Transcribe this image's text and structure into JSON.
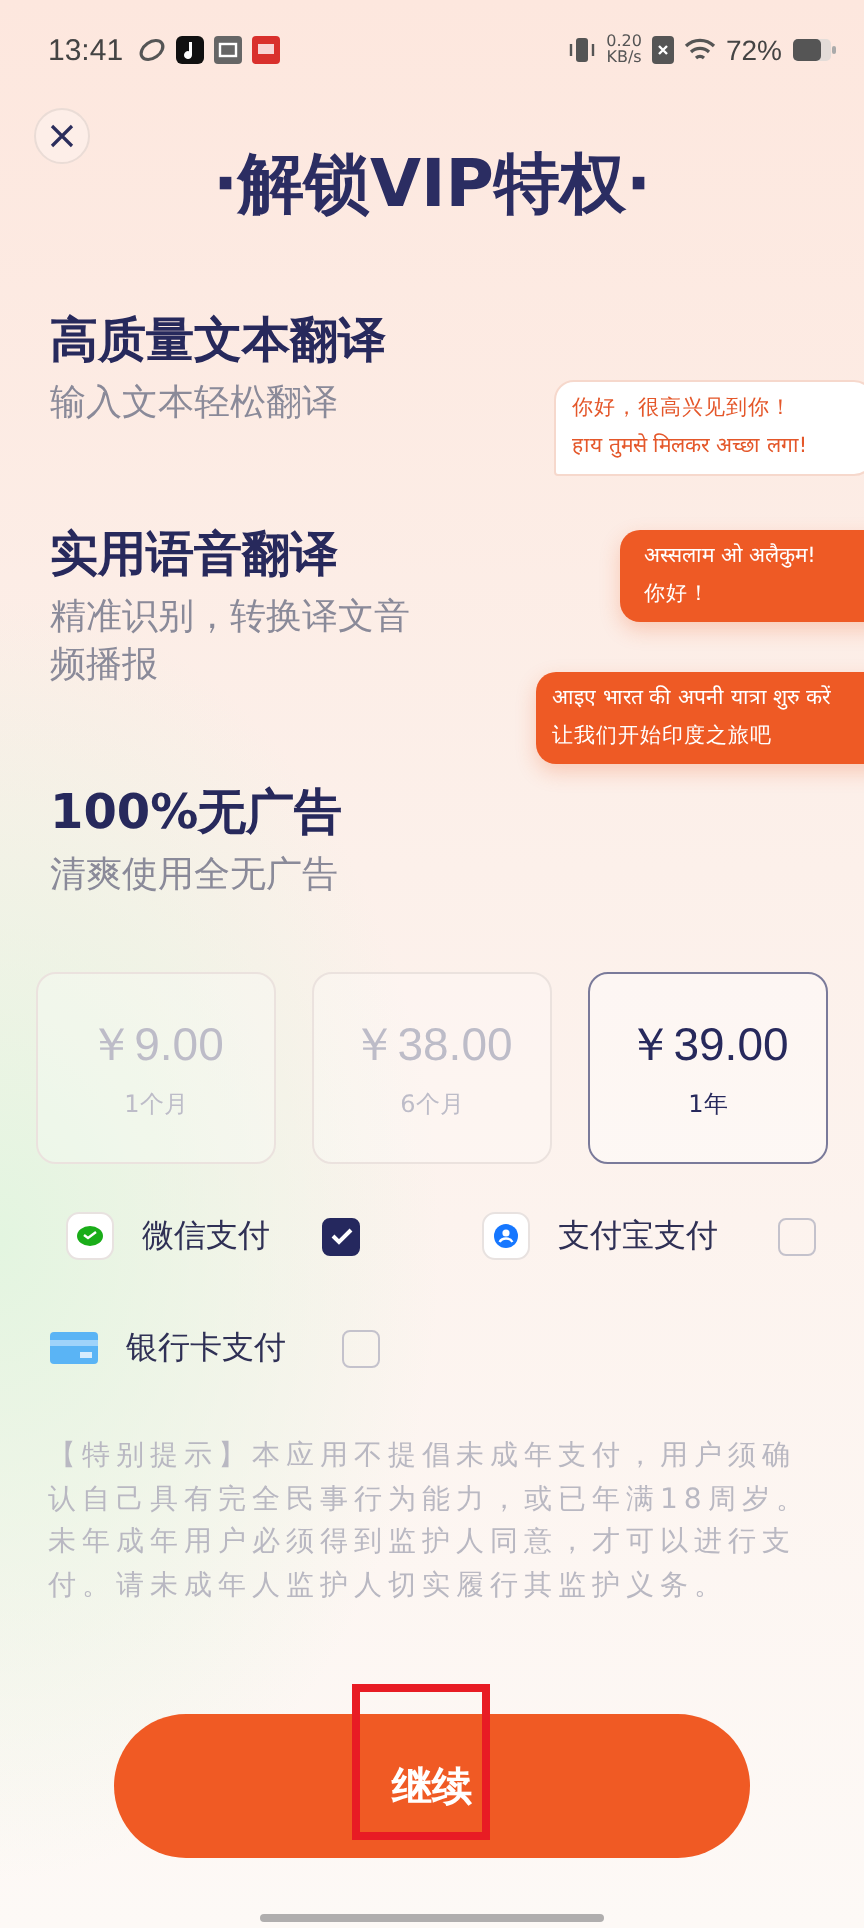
{
  "status_bar": {
    "time": "13:41",
    "net_speed_value": "0.20",
    "net_speed_unit": "KB/s",
    "battery": "72%"
  },
  "title": "·解锁VIP特权·",
  "features": [
    {
      "title": "高质量文本翻译",
      "subtitle": "输入文本轻松翻译"
    },
    {
      "title": "实用语音翻译",
      "subtitle": "精准识别，转换译文音频播报"
    },
    {
      "title": "100%无广告",
      "subtitle": "清爽使用全无广告"
    }
  ],
  "bubbles": [
    {
      "kind": "light",
      "lines": [
        "你好，很高兴见到你！",
        "हाय तुमसे मिलकर अच्छा लगा!"
      ]
    },
    {
      "kind": "dark",
      "lines": [
        "अस्सलाम ओ अलैकुम!",
        "你好！"
      ]
    },
    {
      "kind": "dark",
      "lines": [
        "आइए भारत की अपनी यात्रा शुरु करें",
        "让我们开始印度之旅吧"
      ]
    }
  ],
  "plans": [
    {
      "price": "￥9.00",
      "period": "1个月",
      "selected": false
    },
    {
      "price": "￥38.00",
      "period": "6个月",
      "selected": false
    },
    {
      "price": "￥39.00",
      "period": "1年",
      "selected": true
    }
  ],
  "payment_methods": [
    {
      "kind": "wechat",
      "label": "微信支付",
      "checked": true
    },
    {
      "kind": "alipay",
      "label": "支付宝支付",
      "checked": false
    },
    {
      "kind": "bankcard",
      "label": "银行卡支付",
      "checked": false
    }
  ],
  "notice": "【特别提示】本应用不提倡未成年支付，用户须确认自己具有完全民事行为能力，或已年满18周岁。未年成年用户必须得到监护人同意，才可以进行支付。请未成年人监护人切实履行其监护义务。",
  "continue_button": "继续"
}
